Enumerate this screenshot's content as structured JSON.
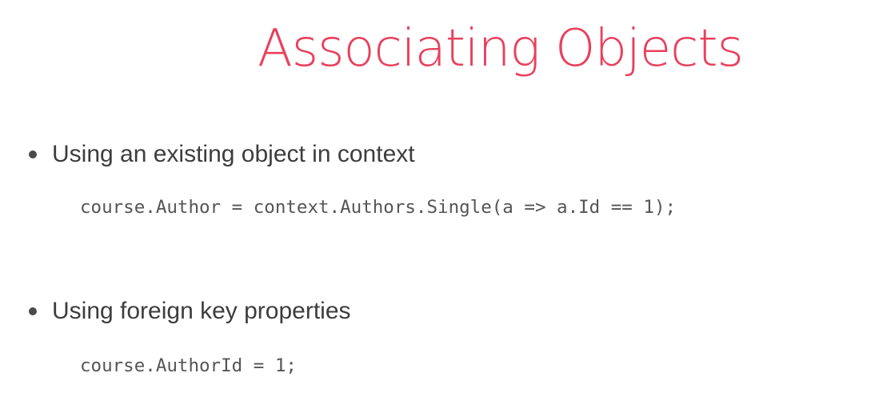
{
  "slide": {
    "title": "Associating Objects",
    "accent_color": "#e8415c",
    "items": [
      {
        "bullet": "Using an existing object in context",
        "code": "course.Author = context.Authors.Single(a => a.Id == 1);"
      },
      {
        "bullet": "Using foreign key properties",
        "code": "course.AuthorId = 1;"
      }
    ]
  }
}
